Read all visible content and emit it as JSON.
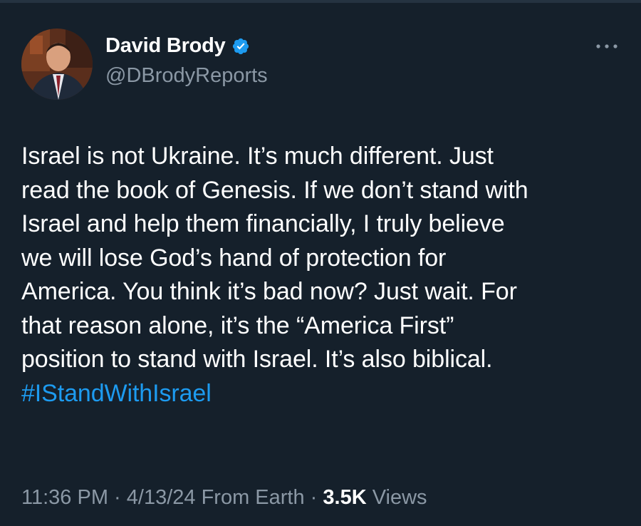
{
  "author": {
    "display_name": "David Brody",
    "handle": "@DBrodyReports",
    "verified": true
  },
  "tweet": {
    "text": "Israel is not Ukraine. It’s much different. Just\nread the book of Genesis. If we don’t stand with\nIsrael and help them financially, I truly believe\nwe will lose God’s hand of protection for\nAmerica. You think it’s bad now? Just wait. For\nthat reason alone, it’s the “America First”\nposition to stand with Israel. It’s also biblical.",
    "hashtag": "#IStandWithIsrael"
  },
  "meta": {
    "time": "11:36 PM",
    "sep1": " · ",
    "date": "4/13/24",
    "source": " From Earth",
    "sep2": " · ",
    "views_count": "3.5K",
    "views_label": " Views"
  },
  "colors": {
    "background": "#15202b",
    "text": "#ffffff",
    "secondary": "#8b98a5",
    "accent": "#1d9bf0"
  },
  "icons": {
    "verified": "verified-badge-icon",
    "more": "more-options-icon"
  }
}
